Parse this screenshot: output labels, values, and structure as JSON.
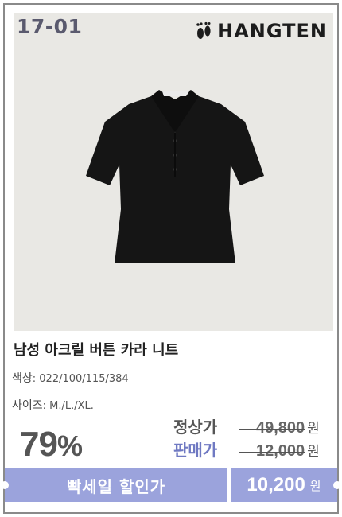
{
  "product_code": "17-01",
  "brand": {
    "name": "HANGTEN",
    "logo_icon": "footprint-icon"
  },
  "product": {
    "title": "남성 아크릴 버튼 카라 니트",
    "color_label": "색상",
    "colors": ": 022/100/115/384",
    "size_label": "사이즈",
    "sizes": ": M./L./XL."
  },
  "pricing": {
    "discount_rate": "79",
    "discount_unit": "%",
    "regular_label": "정상가",
    "regular_price": "49,800",
    "sale_label": "판매가",
    "sale_price": "12,000",
    "currency": "원"
  },
  "flash_sale": {
    "label": "빡세일 할인가",
    "price": "10,200",
    "currency": "원"
  },
  "colors": {
    "accent": "#9ba3dc",
    "sale_label": "#6f79c2",
    "photo_bg": "#e9e8e4"
  }
}
